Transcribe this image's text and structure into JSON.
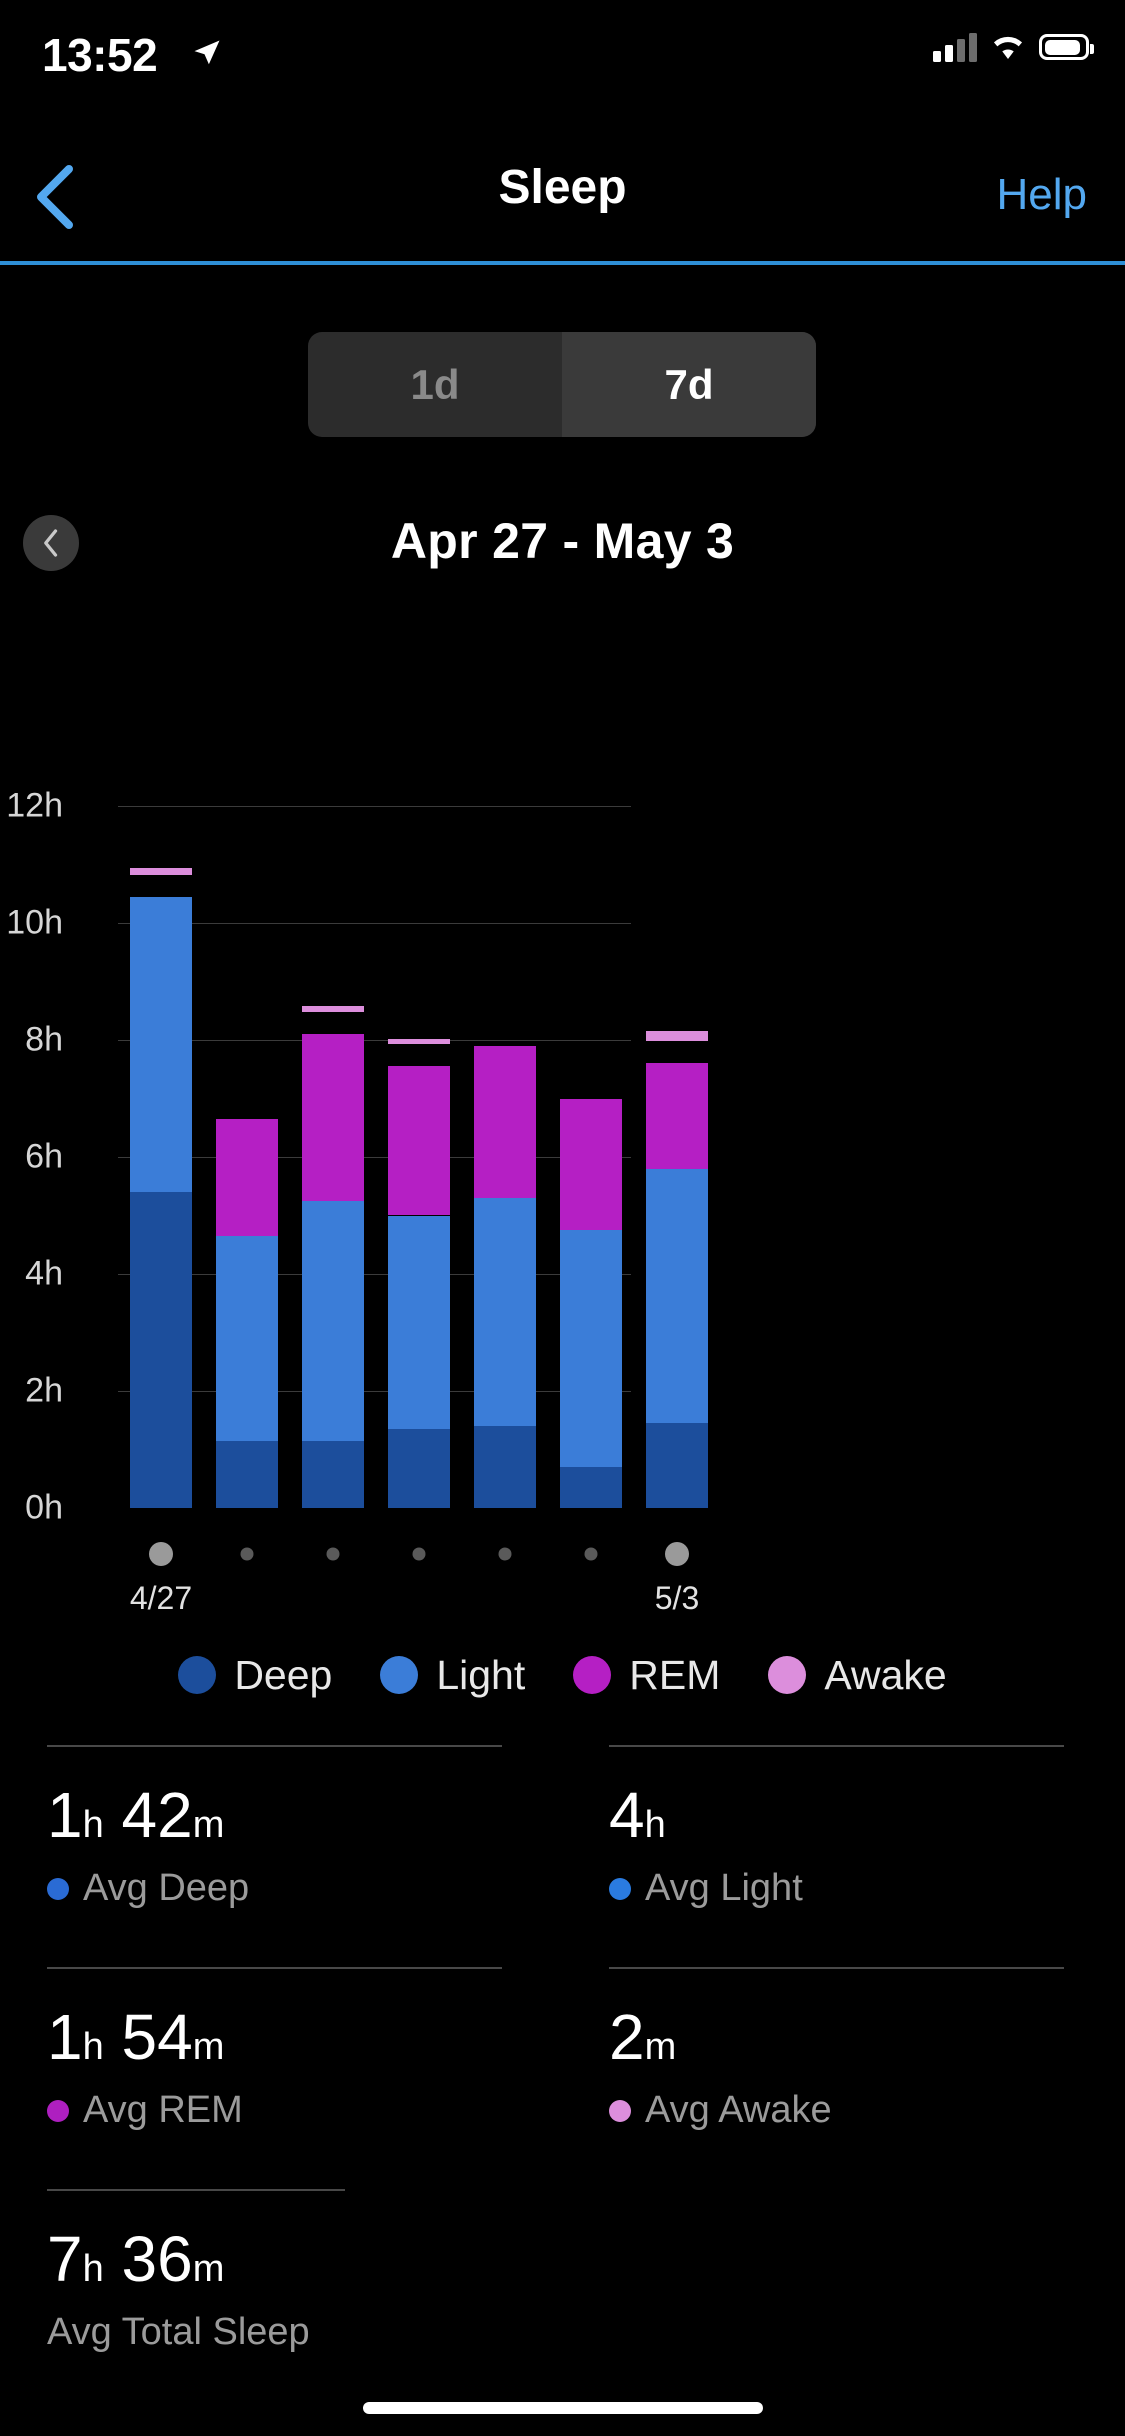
{
  "status_bar": {
    "time": "13:52",
    "icons": [
      "location-arrow-icon",
      "cellular-signal-icon",
      "wifi-icon",
      "battery-icon"
    ]
  },
  "nav": {
    "back_icon": "chevron-left-icon",
    "title": "Sleep",
    "help_label": "Help",
    "separator_color": "#2E8FD6"
  },
  "range_selector": {
    "options": [
      {
        "label": "1d",
        "active": false
      },
      {
        "label": "7d",
        "active": true
      }
    ]
  },
  "date_nav": {
    "prev_icon": "chevron-left-icon",
    "label": "Apr 27 - May 3"
  },
  "legend": [
    {
      "label": "Deep",
      "color": "#1C4E9C"
    },
    {
      "label": "Light",
      "color": "#3B7DD8"
    },
    {
      "label": "REM",
      "color": "#B51FC4"
    },
    {
      "label": "Awake",
      "color": "#DC8EDC"
    }
  ],
  "chart_data": {
    "type": "bar",
    "title": "",
    "xlabel": "",
    "ylabel": "",
    "ylim": [
      0,
      12
    ],
    "grid": true,
    "stacked": true,
    "legend_position": "bottom",
    "yticks": [
      0,
      2,
      4,
      6,
      8,
      10,
      12
    ],
    "ytick_labels": [
      "0h",
      "2h",
      "4h",
      "6h",
      "8h",
      "10h",
      "12h"
    ],
    "categories": [
      "4/27",
      "4/28",
      "4/29",
      "4/30",
      "5/1",
      "5/2",
      "5/3"
    ],
    "xtick_labels_shown": [
      "4/27",
      "",
      "",
      "",
      "",
      "",
      "5/3"
    ],
    "series": [
      {
        "name": "Deep",
        "color": "#1C4E9C",
        "values": [
          5.4,
          1.15,
          1.15,
          1.35,
          1.4,
          0.7,
          1.45
        ]
      },
      {
        "name": "Light",
        "color": "#3B7DD8",
        "values": [
          5.05,
          3.5,
          4.1,
          3.65,
          3.9,
          4.05,
          4.35
        ]
      },
      {
        "name": "REM",
        "color": "#B51FC4",
        "values": [
          0.0,
          2.0,
          2.85,
          2.55,
          2.6,
          2.25,
          1.8
        ]
      },
      {
        "name": "Awake",
        "color": "#DC8EDC",
        "values": [
          0.12,
          0.0,
          0.1,
          0.08,
          0.0,
          0.0,
          0.18
        ]
      }
    ],
    "totals": [
      10.45,
      6.65,
      8.1,
      7.55,
      7.9,
      7.0,
      7.6
    ],
    "selected_index": 0
  },
  "stats": [
    {
      "value_hours": "1",
      "unit_h": "h",
      "value_minutes": "42",
      "unit_m": "m",
      "label": "Avg Deep",
      "dot_color": "#2A6BD4"
    },
    {
      "value_hours": "4",
      "unit_h": "h",
      "value_minutes": "",
      "unit_m": "",
      "label": "Avg Light",
      "dot_color": "#2A7BE0"
    },
    {
      "value_hours": "1",
      "unit_h": "h",
      "value_minutes": "54",
      "unit_m": "m",
      "label": "Avg REM",
      "dot_color": "#AE1FC0"
    },
    {
      "value_hours": "",
      "unit_h": "",
      "value_minutes": "2",
      "unit_m": "m",
      "label": "Avg Awake",
      "dot_color": "#DC8EDC"
    },
    {
      "value_hours": "7",
      "unit_h": "h",
      "value_minutes": "36",
      "unit_m": "m",
      "label": "Avg Total Sleep",
      "dot_color": ""
    }
  ]
}
